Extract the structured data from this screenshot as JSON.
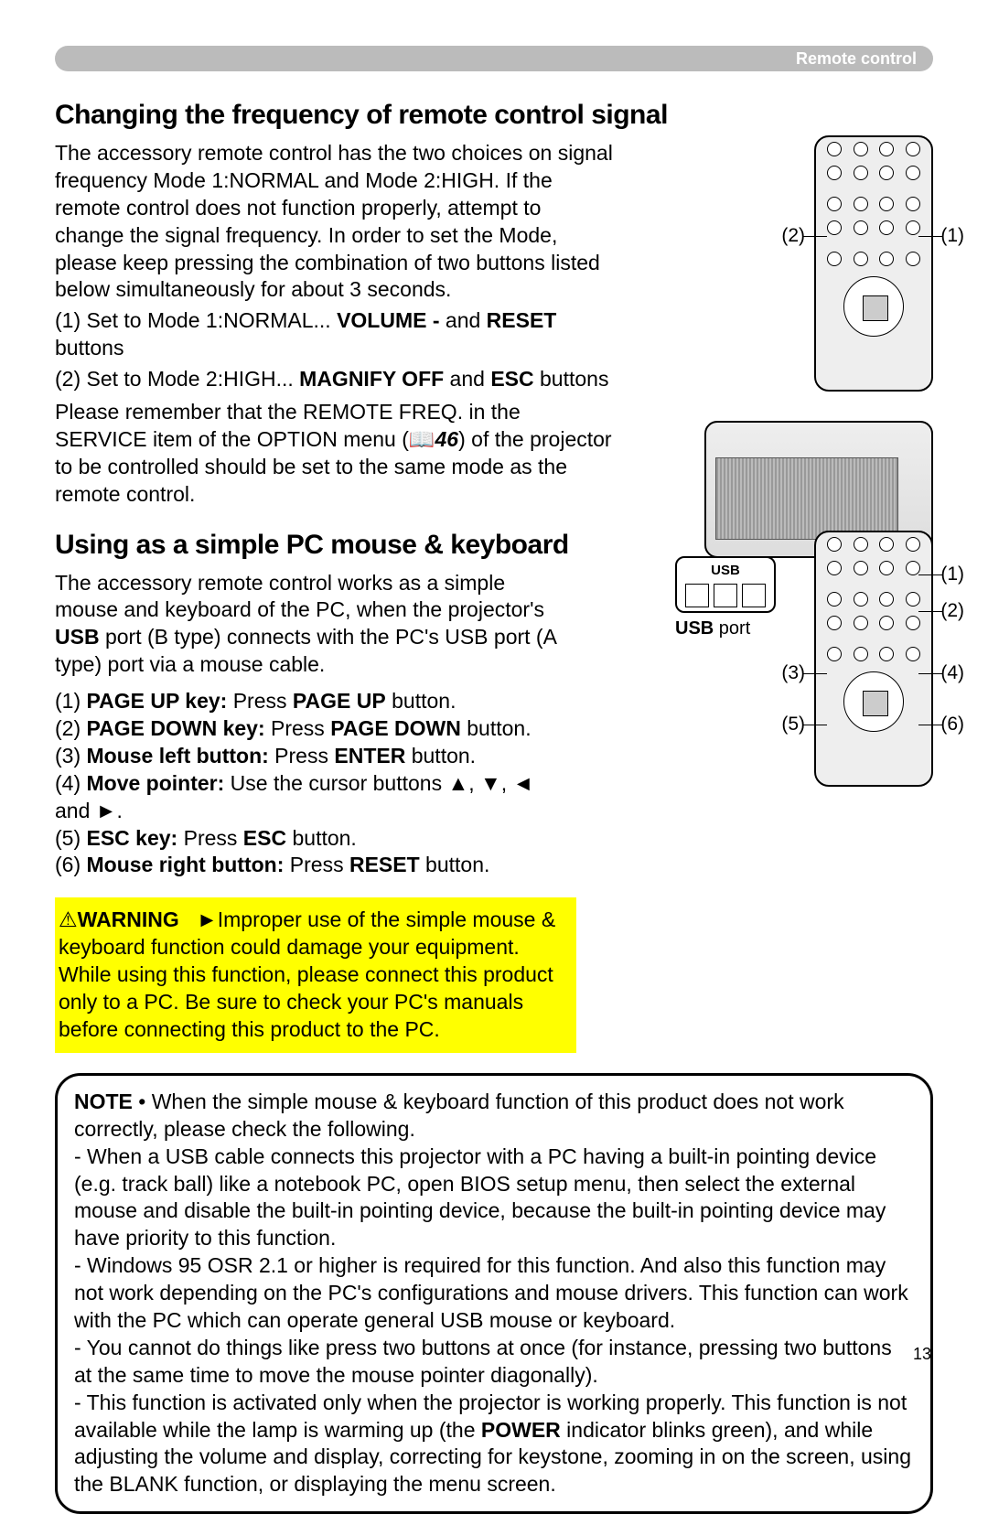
{
  "header": {
    "label": "Remote control"
  },
  "section1": {
    "title": "Changing the frequency of remote control signal",
    "p1": "The accessory remote control has the two choices on signal frequency Mode 1:NORMAL and Mode 2:HIGH. If the remote control does not function properly, attempt to change the signal frequency. In order to set the Mode, please keep pressing the combination of two buttons listed below simultaneously for about 3 seconds.",
    "p2a": "(1) Set to Mode 1:NORMAL... ",
    "p2b": "VOLUME -",
    "p2c": " and ",
    "p2d": "RESET",
    "p2e": " buttons",
    "p3a": "(2) Set to Mode 2:HIGH... ",
    "p3b": "MAGNIFY OFF",
    "p3c": " and ",
    "p3d": "ESC",
    "p3e": " buttons",
    "p4a": "Please remember that the REMOTE FREQ. in the SERVICE item of the OPTION menu (",
    "p4icon": "📖",
    "p4page": "46",
    "p4b": ") of the projector to be controlled should be set to the same mode as the remote control."
  },
  "section2": {
    "title": "Using as a simple PC mouse & keyboard",
    "p1a": "The accessory remote control works as a simple mouse and keyboard of the PC, when the projector's ",
    "p1b": "USB",
    "p1c": " port (B type) connects with the PC's USB port (A type) port via a mouse cable.",
    "l1a": "(1) ",
    "l1b": "PAGE UP key:",
    "l1c": " Press ",
    "l1d": "PAGE UP",
    "l1e": " button.",
    "l2a": "(2) ",
    "l2b": "PAGE DOWN key:",
    "l2c": " Press ",
    "l2d": "PAGE DOWN",
    "l2e": " button.",
    "l3a": "(3) ",
    "l3b": "Mouse left button:",
    "l3c": " Press ",
    "l3d": "ENTER",
    "l3e": " button.",
    "l4a": "(4) ",
    "l4b": "Move pointer:",
    "l4c": " Use the cursor buttons ▲, ▼, ◄ and ►.",
    "l5a": "(5) ",
    "l5b": "ESC key:",
    "l5c": " Press ",
    "l5d": "ESC",
    "l5e": " button.",
    "l6a": "(6) ",
    "l6b": "Mouse right button:",
    "l6c": " Press ",
    "l6d": "RESET",
    "l6e": " button."
  },
  "warning": {
    "icon": "⚠",
    "lead": "WARNING",
    "arrow": "►",
    "text": "Improper use of the simple mouse & keyboard function could damage your equipment. While using this function, please connect this product only to a PC. Be sure to check your PC's manuals before connecting this product to the PC."
  },
  "note": {
    "lead": "NOTE",
    "intro": "  • When the simple mouse & keyboard function of this product does not work correctly, please check the following.",
    "b1": "- When a USB cable connects this projector with a PC having a built-in pointing device (e.g. track ball) like a notebook PC, open BIOS setup menu, then select the external mouse and disable the built-in pointing device, because the built-in pointing device may have priority to this function.",
    "b2": "- Windows 95 OSR 2.1 or higher is required for this function. And also this function may not work depending on the PC's configurations and mouse drivers. This function can work with the PC which can operate general USB mouse or keyboard.",
    "b3": "- You cannot do things like press two buttons at once (for instance, pressing two buttons at the same time to move the mouse pointer diagonally).",
    "b4a": "- This function is activated only when the projector is working properly. This function is not available while the lamp is warming up (the ",
    "b4b": "POWER",
    "b4c": " indicator blinks green), and while adjusting the volume and display, correcting for keystone, zooming in on the screen, using the BLANK function, or displaying the menu screen."
  },
  "callouts": {
    "r1_left": "(2)",
    "r1_right": "(1)",
    "r2_1": "(1)",
    "r2_2": "(2)",
    "r2_3": "(3)",
    "r2_4": "(4)",
    "r2_5": "(5)",
    "r2_6": "(6)"
  },
  "usb": {
    "title": "USB",
    "port": "USB",
    "port2": " port"
  },
  "page": "13"
}
